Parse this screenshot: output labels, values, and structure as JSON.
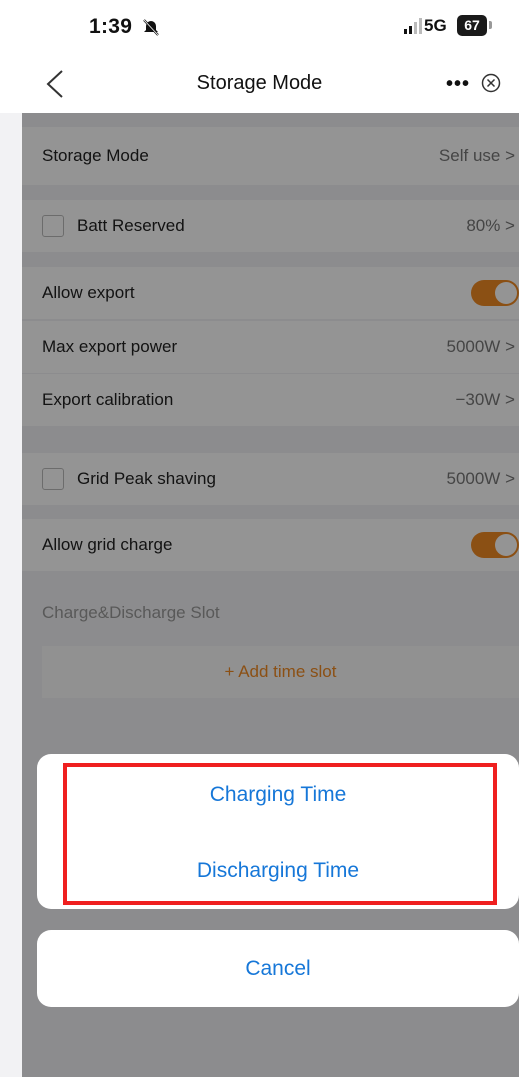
{
  "status_bar": {
    "time": "1:39",
    "network": "5G",
    "battery": "67"
  },
  "nav": {
    "title": "Storage Mode",
    "more": "•••"
  },
  "settings": {
    "storage_mode": {
      "label": "Storage Mode",
      "value": "Self use >"
    },
    "batt_reserved": {
      "label": "Batt Reserved",
      "value": "80% >",
      "checked": false
    },
    "allow_export": {
      "label": "Allow export",
      "on": true
    },
    "max_export_power": {
      "label": "Max export power",
      "value": "5000W >"
    },
    "export_calibration": {
      "label": "Export calibration",
      "value": "−30W >"
    },
    "grid_peak_shaving": {
      "label": "Grid Peak shaving",
      "value": "5000W >",
      "checked": false
    },
    "allow_grid_charge": {
      "label": "Allow grid charge",
      "on": true
    }
  },
  "slots": {
    "section_title": "Charge&Discharge Slot",
    "add_label": "+ Add time slot"
  },
  "action_sheet": {
    "options": [
      "Charging Time",
      "Discharging Time"
    ],
    "cancel": "Cancel"
  },
  "colors": {
    "accent": "#f08a24",
    "link": "#1677d8",
    "highlight": "#ef1f1f"
  }
}
